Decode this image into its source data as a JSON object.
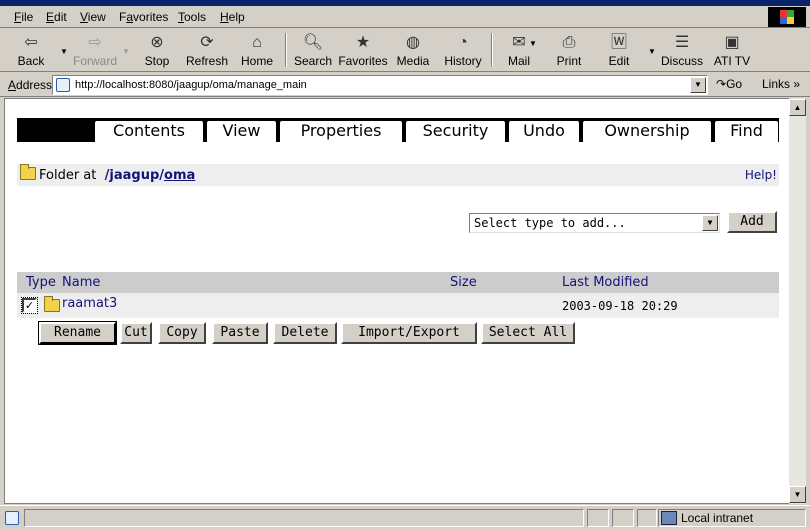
{
  "menu": {
    "items": [
      {
        "prefix": "",
        "key": "F",
        "rest": "ile"
      },
      {
        "prefix": "",
        "key": "E",
        "rest": "dit"
      },
      {
        "prefix": "",
        "key": "V",
        "rest": "iew"
      },
      {
        "prefix": "F",
        "key": "a",
        "rest": "vorites"
      },
      {
        "prefix": "",
        "key": "T",
        "rest": "ools"
      },
      {
        "prefix": "",
        "key": "H",
        "rest": "elp"
      }
    ]
  },
  "toolbar": {
    "back": "Back",
    "forward": "Forward",
    "stop": "Stop",
    "refresh": "Refresh",
    "home": "Home",
    "search": "Search",
    "favorites": "Favorites",
    "media": "Media",
    "history": "History",
    "mail": "Mail",
    "print": "Print",
    "edit": "Edit",
    "discuss": "Discuss",
    "ati_tv": "ATI TV"
  },
  "address": {
    "label_prefix": "A",
    "label_rest": "ddress",
    "url": "http://localhost:8080/jaagup/oma/manage_main",
    "go": "Go",
    "links": "Links"
  },
  "tabs": [
    "Contents",
    "View",
    "Properties",
    "Security",
    "Undo",
    "Ownership",
    "Find"
  ],
  "folder": {
    "label": "Folder at",
    "path_root": "/jaagup",
    "path_sep": "/",
    "path_current": "oma",
    "help": "Help!"
  },
  "add_type": {
    "selected": "Select type to add...",
    "button": "Add"
  },
  "list": {
    "columns": {
      "type": "Type",
      "name": "Name",
      "size": "Size",
      "modified": "Last Modified"
    },
    "rows": [
      {
        "name": "raamat3",
        "size": "",
        "modified": "2003-09-18 20:29",
        "checked": true
      }
    ]
  },
  "actions": [
    "Rename",
    "Cut",
    "Copy",
    "Paste",
    "Delete",
    "Import/Export",
    "Select All"
  ],
  "status": {
    "zone": "Local intranet"
  }
}
